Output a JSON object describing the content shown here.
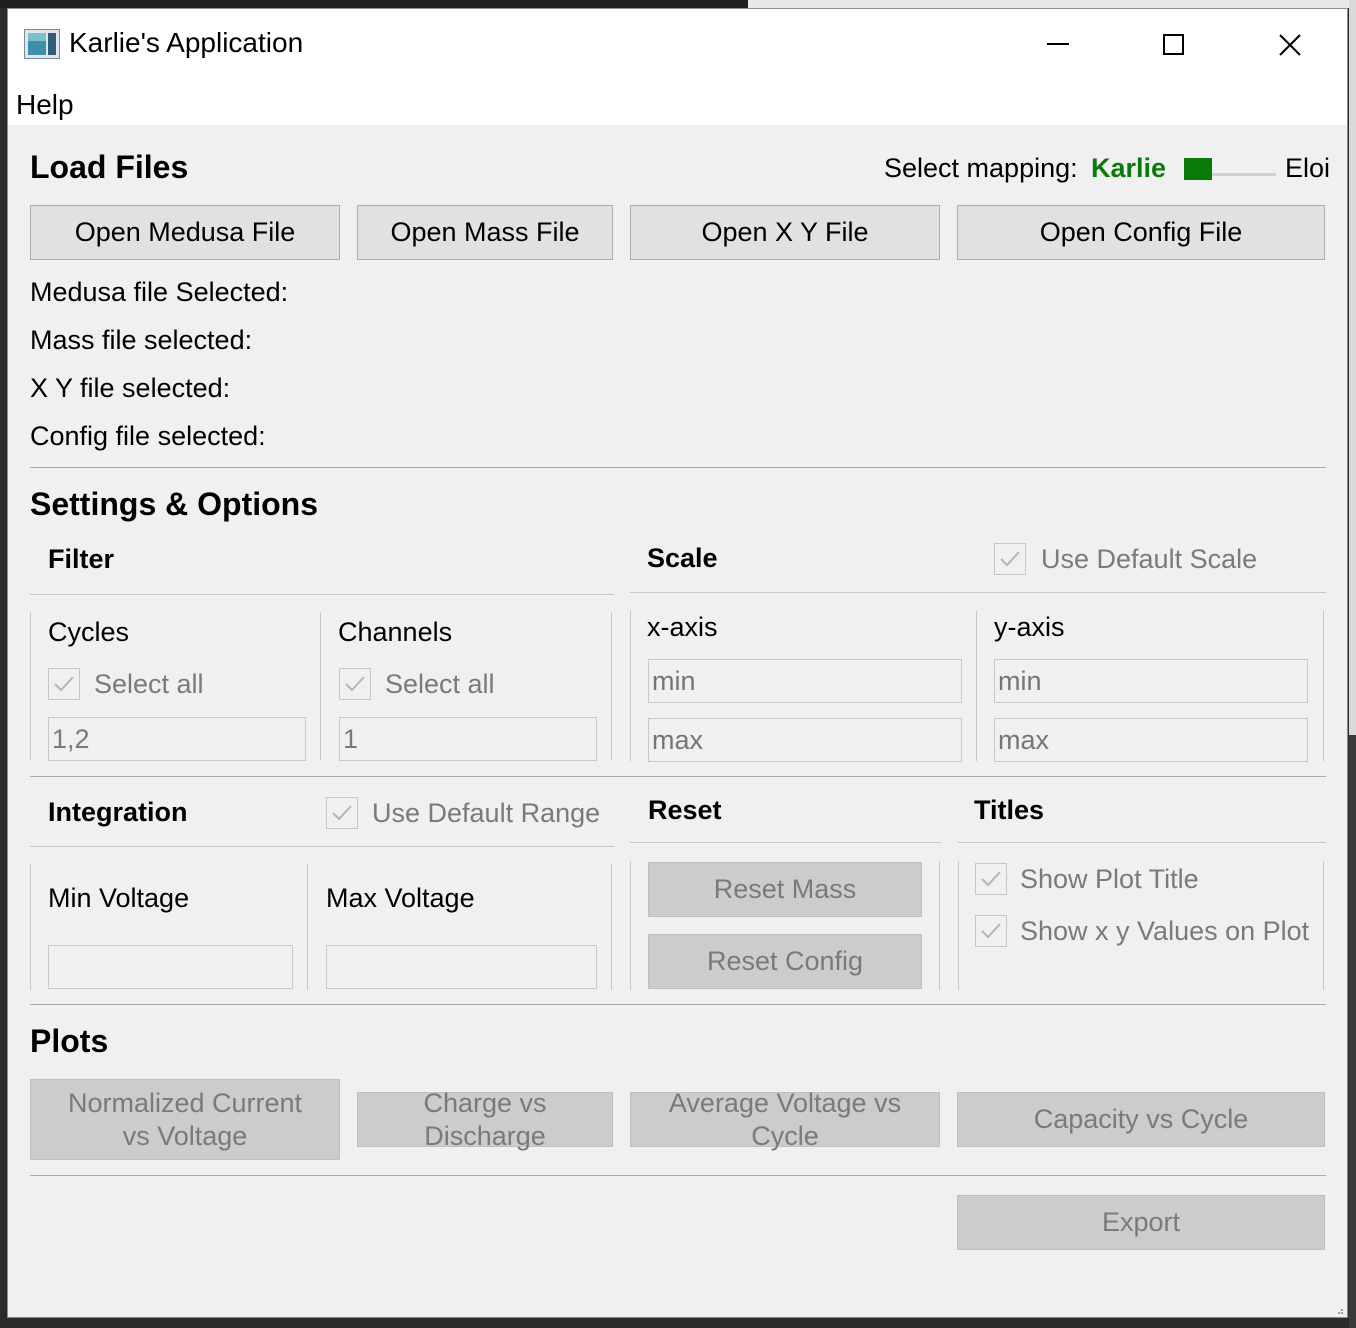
{
  "window": {
    "title": "Karlie's Application"
  },
  "menu": {
    "help": "Help"
  },
  "load_files": {
    "heading": "Load Files",
    "mapping_label": "Select mapping:",
    "mapping_option_left": "Karlie",
    "mapping_option_right": "Eloi",
    "mapping_selected": "Karlie",
    "buttons": {
      "open_medusa": "Open Medusa File",
      "open_mass": "Open Mass File",
      "open_xy": "Open X Y File",
      "open_config": "Open Config File"
    },
    "status": {
      "medusa": "Medusa file Selected:",
      "mass": "Mass file selected:",
      "xy": "X Y file selected:",
      "config": "Config file selected:"
    }
  },
  "settings": {
    "heading": "Settings & Options",
    "filter": {
      "title": "Filter",
      "cycles_label": "Cycles",
      "cycles_select_all": "Select all",
      "cycles_value": "1,2",
      "channels_label": "Channels",
      "channels_select_all": "Select all",
      "channels_value": "1"
    },
    "scale": {
      "title": "Scale",
      "use_default": "Use Default Scale",
      "x_axis_label": "x-axis",
      "y_axis_label": "y-axis",
      "x_min_placeholder": "min",
      "x_max_placeholder": "max",
      "y_min_placeholder": "min",
      "y_max_placeholder": "max"
    },
    "integration": {
      "title": "Integration",
      "use_default_range": "Use Default Range",
      "min_voltage_label": "Min Voltage",
      "max_voltage_label": "Max Voltage",
      "min_voltage_value": "",
      "max_voltage_value": ""
    },
    "reset": {
      "title": "Reset",
      "reset_mass": "Reset Mass",
      "reset_config": "Reset Config"
    },
    "titles": {
      "title": "Titles",
      "show_plot_title": "Show Plot Title",
      "show_xy_values": "Show x y Values on Plot"
    }
  },
  "plots": {
    "heading": "Plots",
    "normalized_line1": "Normalized Current",
    "normalized_line2": "vs Voltage",
    "charge_vs_discharge": "Charge vs Discharge",
    "average_voltage_vs_cycle": "Average Voltage vs Cycle",
    "capacity_vs_cycle": "Capacity vs Cycle",
    "export": "Export"
  },
  "colors": {
    "mapping_active": "#0a7a0a",
    "window_bg": "#f0f0f0",
    "disabled_text": "#7a7a7a"
  }
}
